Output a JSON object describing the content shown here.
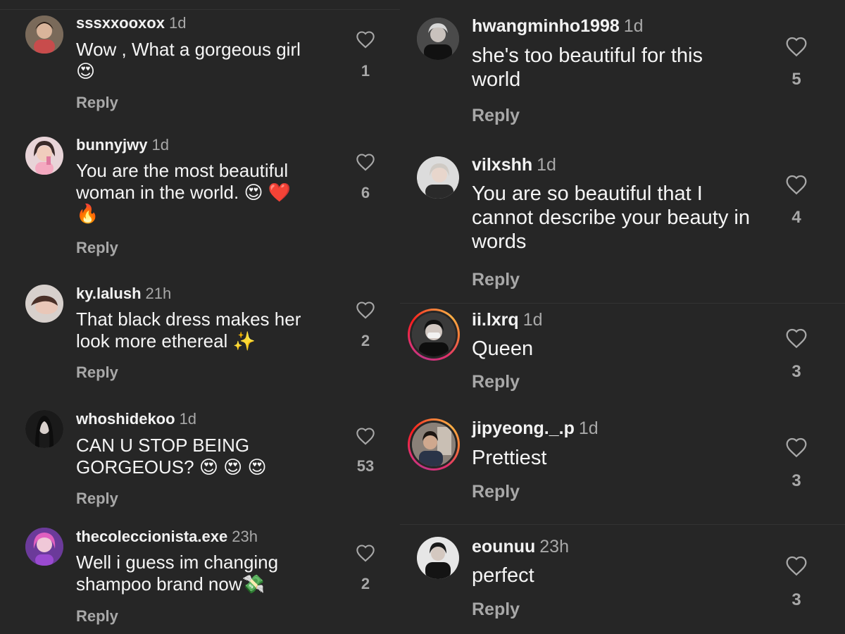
{
  "left_comments": [
    {
      "username": "sssxxooxox",
      "time": "1d",
      "text": "Wow , What a gorgeous girl",
      "emoji": "😍",
      "reply": "Reply",
      "likes": "1"
    },
    {
      "username": "bunnyjwy",
      "time": "1d",
      "text": "You are the most beautiful woman in the world. 😍 ❤️",
      "emoji": "🔥",
      "reply": "Reply",
      "likes": "6"
    },
    {
      "username": "ky.lalush",
      "time": "21h",
      "text": "That black dress makes her look more ethereal ✨",
      "emoji": "",
      "reply": "Reply",
      "likes": "2"
    },
    {
      "username": "whoshidekoo",
      "time": "1d",
      "text": "CAN U STOP BEING GORGEOUS? 😍 😍 😍",
      "emoji": "",
      "reply": "Reply",
      "likes": "53"
    },
    {
      "username": "thecoleccionista.exe",
      "time": "23h",
      "text": "Well i guess im changing shampoo brand now💸",
      "emoji": "",
      "reply": "Reply",
      "likes": "2"
    }
  ],
  "right_comments": [
    {
      "username": "hwangminho1998",
      "time": "1d",
      "text": "she's too beautiful for this world",
      "reply": "Reply",
      "likes": "5"
    },
    {
      "username": "vilxshh",
      "time": "1d",
      "text": "You are so beautiful that I cannot describe your beauty in words",
      "reply": "Reply",
      "likes": "4"
    },
    {
      "username": "ii.lxrq",
      "time": "1d",
      "text": "Queen",
      "reply": "Reply",
      "likes": "3"
    },
    {
      "username": "jipyeong._.p",
      "time": "1d",
      "text": "Prettiest",
      "reply": "Reply",
      "likes": "3"
    },
    {
      "username": "eounuu",
      "time": "23h",
      "text": "perfect",
      "reply": "Reply",
      "likes": "3"
    }
  ],
  "colors": {
    "background": "#262626",
    "username": "#f2f2f2",
    "secondary_text": "#a8a8a8",
    "story_ring_start": "#c13584",
    "story_ring_end": "#fcaf45"
  },
  "icons": {
    "like": "heart-outline-icon"
  }
}
